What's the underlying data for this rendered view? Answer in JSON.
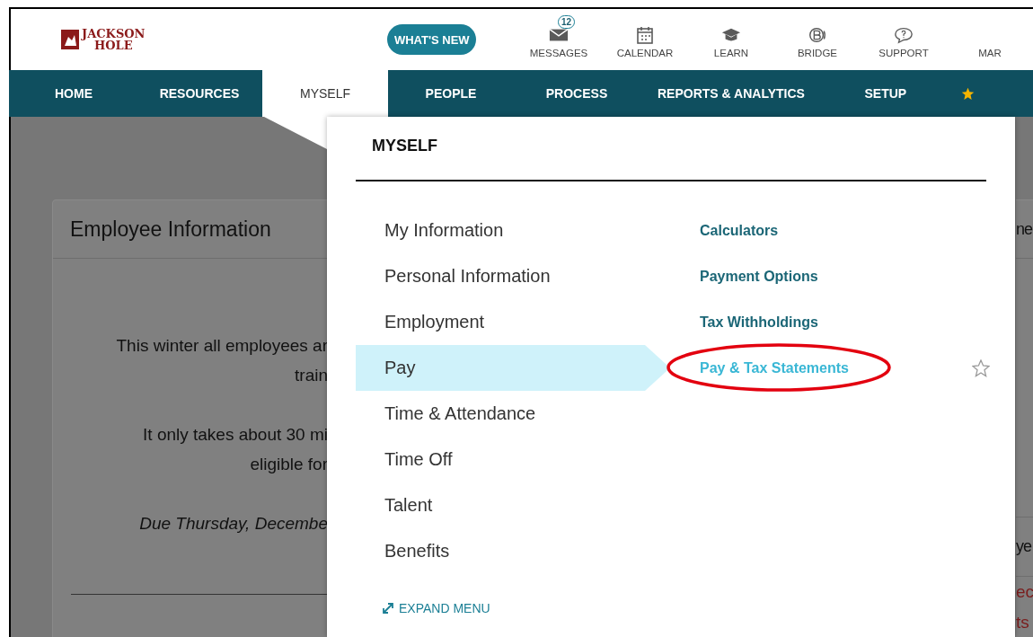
{
  "header": {
    "logo": [
      "JACKSON",
      "HOLE"
    ],
    "whats_new": "WHAT'S NEW",
    "tools": [
      {
        "kind": "envelope",
        "label": "MESSAGES",
        "badge": "12"
      },
      {
        "kind": "calendar",
        "label": "CALENDAR"
      },
      {
        "kind": "cap",
        "label": "LEARN"
      },
      {
        "kind": "bridge",
        "label": "BRIDGE"
      },
      {
        "kind": "chat",
        "label": "SUPPORT"
      },
      {
        "kind": "none",
        "label": "MAR"
      }
    ]
  },
  "nav": [
    {
      "label": "HOME",
      "selected": false
    },
    {
      "label": "RESOURCES",
      "selected": false
    },
    {
      "label": "MYSELF",
      "selected": true
    },
    {
      "label": "PEOPLE",
      "selected": false
    },
    {
      "label": "PROCESS",
      "selected": false
    },
    {
      "label": "REPORTS & ANALYTICS",
      "selected": false
    },
    {
      "label": "SETUP",
      "selected": false
    }
  ],
  "card": {
    "title": "Employee Information",
    "paragraphs": [
      {
        "lines": [
          "This winter all employees ar",
          "train"
        ],
        "italic": false
      },
      {
        "lines": [
          "It only takes about 30 mi",
          "eligible for"
        ],
        "italic": false
      },
      {
        "lines": [
          "Due Thursday, Decembe"
        ],
        "italic": true
      }
    ]
  },
  "right_edge": {
    "header": "ne",
    "subheader": "ye",
    "lines": [
      "ec",
      "ts"
    ]
  },
  "menu": {
    "title": "MYSELF",
    "sections": [
      {
        "label": "My Information",
        "selected": false
      },
      {
        "label": "Personal Information",
        "selected": false
      },
      {
        "label": "Employment",
        "selected": false
      },
      {
        "label": "Pay",
        "selected": true
      },
      {
        "label": "Time & Attendance",
        "selected": false
      },
      {
        "label": "Time Off",
        "selected": false
      },
      {
        "label": "Talent",
        "selected": false
      },
      {
        "label": "Benefits",
        "selected": false
      }
    ],
    "links": [
      {
        "label": "Calculators",
        "selected": false,
        "circled": false
      },
      {
        "label": "Payment Options",
        "selected": false,
        "circled": false
      },
      {
        "label": "Tax Withholdings",
        "selected": false,
        "circled": false
      },
      {
        "label": "Pay & Tax Statements",
        "selected": true,
        "circled": true,
        "favorite": false
      }
    ],
    "expand": "EXPAND MENU"
  }
}
